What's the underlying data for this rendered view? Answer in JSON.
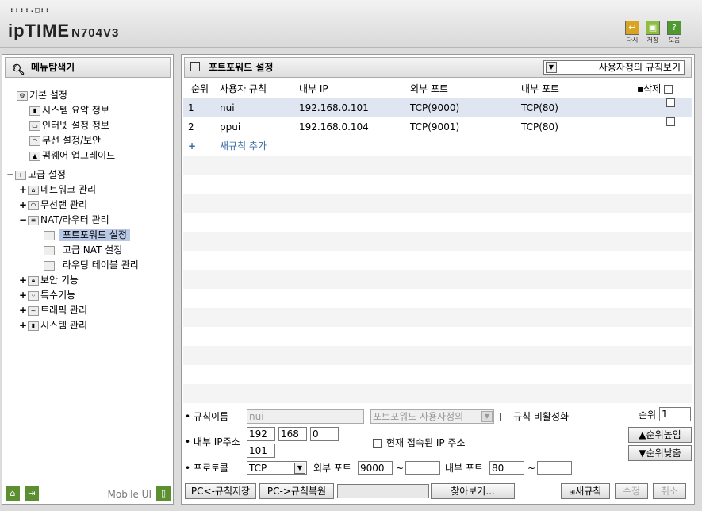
{
  "header": {
    "dots": "::::.□:: ",
    "logo": "ipTIME",
    "model": "N704V3",
    "buttons": [
      {
        "icon": "undo-icon",
        "label": "다시"
      },
      {
        "icon": "save-icon",
        "label": "저장"
      },
      {
        "icon": "help-icon",
        "label": "도움"
      }
    ]
  },
  "sidebar": {
    "title": "메뉴탐색기",
    "footer_label": "Mobile UI",
    "items": [
      {
        "label": "기본 설정",
        "icon": "folder-settings-icon",
        "pm": ""
      },
      {
        "label": "시스템 요약 정보",
        "icon": "chart-icon",
        "pm": ""
      },
      {
        "label": "인터넷 설정 정보",
        "icon": "monitor-icon",
        "pm": ""
      },
      {
        "label": "무선 설정/보안",
        "icon": "wireless-icon",
        "pm": ""
      },
      {
        "label": "펌웨어 업그레이드",
        "icon": "upgrade-icon",
        "pm": ""
      },
      {
        "label": "고급 설정",
        "icon": "folder-advanced-icon",
        "pm": "−"
      },
      {
        "label": "네트워크 관리",
        "icon": "network-icon",
        "pm": "+"
      },
      {
        "label": "무선랜 관리",
        "icon": "wireless-icon",
        "pm": "+"
      },
      {
        "label": "NAT/라우터 관리",
        "icon": "router-icon",
        "pm": "−"
      },
      {
        "label": "포트포워드 설정",
        "icon": "page-icon",
        "pm": ""
      },
      {
        "label": "고급 NAT 설정",
        "icon": "page-icon",
        "pm": ""
      },
      {
        "label": "라우팅 테이블 관리",
        "icon": "page-icon",
        "pm": ""
      },
      {
        "label": "보안 기능",
        "icon": "lock-icon",
        "pm": "+"
      },
      {
        "label": "특수기능",
        "icon": "special-icon",
        "pm": "+"
      },
      {
        "label": "트래픽 관리",
        "icon": "traffic-icon",
        "pm": "+"
      },
      {
        "label": "시스템 관리",
        "icon": "system-icon",
        "pm": "+"
      }
    ]
  },
  "main": {
    "title": "포트포워드 설정",
    "view_select": "사용자정의 규칙보기",
    "columns": [
      "순위",
      "사용자 규칙",
      "내부 IP",
      "외부 포트",
      "내부 포트",
      "삭제"
    ],
    "rows": [
      {
        "rank": "1",
        "name": "nui",
        "ip": "192.168.0.101",
        "ext": "TCP(9000)",
        "int": "TCP(80)"
      },
      {
        "rank": "2",
        "name": "ppui",
        "ip": "192.168.0.104",
        "ext": "TCP(9001)",
        "int": "TCP(80)"
      }
    ],
    "add_icon": "+",
    "add_label": "새규칙 추가"
  },
  "form": {
    "rule_name_label": "규칙이름",
    "rule_name_value": "nui",
    "preset": "포트포워드 사용자정의",
    "disable_label": "규칙 비활성화",
    "rank_label": "순위",
    "rank_value": "1",
    "up": "▲순위높임",
    "down": "▼순위낮춤",
    "ip_label": "내부 IP주소",
    "ip1": "192",
    "ip2": "168",
    "ip3": "0",
    "ip4": "101",
    "current_ip_label": "현재 접속된 IP 주소",
    "proto_label": "프로토콜",
    "proto_value": "TCP",
    "ext_label": "외부 포트",
    "ext_from": "9000",
    "ext_to": "",
    "int_label": "내부 포트",
    "int_from": "80",
    "int_to": "",
    "tilde": "~",
    "save_btn": "PC<-규칙저장",
    "restore_btn": "PC->규칙복원",
    "browse_btn": "찾아보기...",
    "new_btn": "새규칙",
    "edit_btn": "수정",
    "cancel_btn": "취소"
  }
}
